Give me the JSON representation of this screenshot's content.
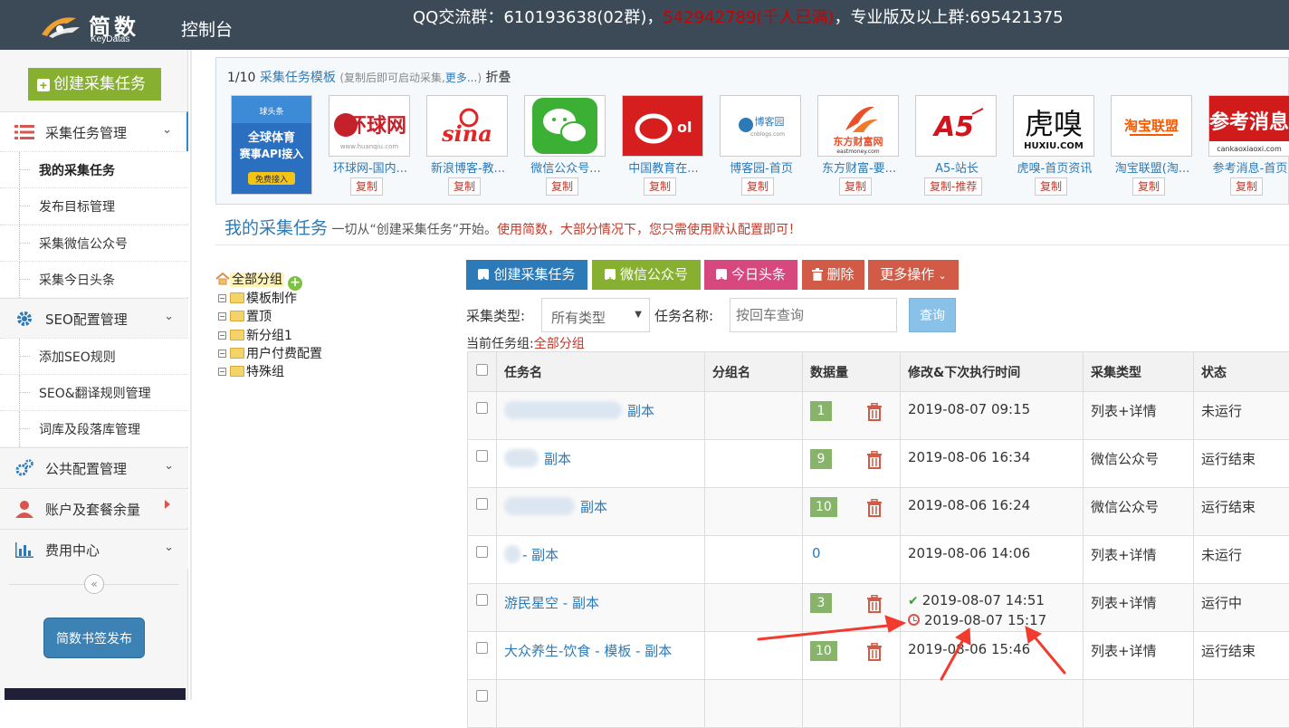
{
  "header": {
    "logo_name": "简数",
    "logo_sub": "KeyDatas",
    "console_label": "控制台",
    "qq_prefix": "QQ交流群：610193638(02群)，",
    "qq_full": "542942789(千人已满)",
    "qq_suffix": "，专业版及以上群:695421375"
  },
  "sidebar": {
    "create_label": "创建采集任务",
    "sections": [
      {
        "label": "采集任务管理",
        "icon": "list-icon",
        "items": [
          "我的采集任务",
          "发布目标管理",
          "采集微信公众号",
          "采集今日头条"
        ]
      },
      {
        "label": "SEO配置管理",
        "icon": "gear-icon",
        "items": [
          "添加SEO规则",
          "SEO&翻译规则管理",
          "词库及段落库管理"
        ]
      },
      {
        "label": "公共配置管理",
        "icon": "gears-icon"
      },
      {
        "label": "账户及套餐余量",
        "icon": "user-icon"
      },
      {
        "label": "费用中心",
        "icon": "bar-chart-icon"
      }
    ],
    "collapse_glyph": "«",
    "publish_label": "简数书签发布"
  },
  "templates": {
    "counter": "1/10",
    "title": "采集任务模板",
    "hint": "(复制后即可启动采集,",
    "more": "更多...",
    "hint_end": ")",
    "fold": "折叠",
    "items": [
      {
        "name": "",
        "thumb": "球头条 全球体育 赛事API接入 免费接入",
        "copy": ""
      },
      {
        "name": "环球网-国内...",
        "thumb": "环球网",
        "copy": "复制"
      },
      {
        "name": "新浪博客-教...",
        "thumb": "sina",
        "copy": "复制"
      },
      {
        "name": "微信公众号...",
        "thumb": "wechat",
        "copy": "复制"
      },
      {
        "name": "中国教育在...",
        "thumb": "eol",
        "copy": "复制"
      },
      {
        "name": "博客园-首页",
        "thumb": "博客园",
        "copy": "复制"
      },
      {
        "name": "东方财富-要...",
        "thumb": "东方财富网",
        "copy": "复制"
      },
      {
        "name": "A5-站长",
        "thumb": "A5",
        "copy": "复制-推荐"
      },
      {
        "name": "虎嗅-首页资讯",
        "thumb": "虎嗅",
        "copy": "复制"
      },
      {
        "name": "淘宝联盟(淘...",
        "thumb": "淘宝联盟",
        "copy": "复制"
      },
      {
        "name": "参考消息-首页",
        "thumb": "参考消息",
        "copy": "复制"
      }
    ]
  },
  "heading": {
    "title": "我的采集任务",
    "sub": "一切从“创建采集任务”开始。",
    "tip": "使用简数，大部分情况下，您只需使用默认配置即可！"
  },
  "tree": {
    "root": "全部分组",
    "nodes": [
      "模板制作",
      "置顶",
      "新分组1",
      "用户付费配置",
      "特殊组"
    ]
  },
  "actions": {
    "create": "创建采集任务",
    "wechat": "微信公众号",
    "toutiao": "今日头条",
    "delete": "删除",
    "more": "更多操作"
  },
  "filters": {
    "type_label": "采集类型:",
    "type_value": "所有类型",
    "name_label": "任务名称:",
    "name_placeholder": "按回车查询",
    "query": "查询",
    "current_label": "当前任务组:",
    "current_value": "全部分组"
  },
  "table": {
    "columns": [
      "任务名",
      "分组名",
      "数据量",
      "修改&下次执行时间",
      "采集类型",
      "状态"
    ],
    "rows": [
      {
        "name": "副本",
        "group": "",
        "count": "1",
        "time": "2019-08-07 09:15",
        "next": "",
        "type": "列表+详情",
        "status": "未运行"
      },
      {
        "name": "副本",
        "group": "",
        "count": "9",
        "time": "2019-08-06 16:34",
        "next": "",
        "type": "微信公众号",
        "status": "运行结束"
      },
      {
        "name": "副本",
        "group": "",
        "count": "10",
        "time": "2019-08-06 16:24",
        "next": "",
        "type": "微信公众号",
        "status": "运行结束"
      },
      {
        "name": "- 副本",
        "group": "",
        "count": "0",
        "time": "2019-08-06 14:06",
        "next": "",
        "type": "列表+详情",
        "status": "未运行"
      },
      {
        "name": "游民星空 - 副本",
        "group": "",
        "count": "3",
        "time": "2019-08-07 14:51",
        "next": "2019-08-07 15:17",
        "type": "列表+详情",
        "status": "运行中"
      },
      {
        "name": "大众养生-饮食 - 模板 - 副本",
        "group": "",
        "count": "10",
        "time": "2019-08-06 15:46",
        "next": "",
        "type": "列表+详情",
        "status": "运行结束"
      }
    ]
  },
  "colors": {
    "topbar": "#3c4a57",
    "accent_blue": "#2d7ab8",
    "green": "#87b030",
    "pink": "#d6487e",
    "red": "#d15b47",
    "annotation": "#f23a2e"
  }
}
